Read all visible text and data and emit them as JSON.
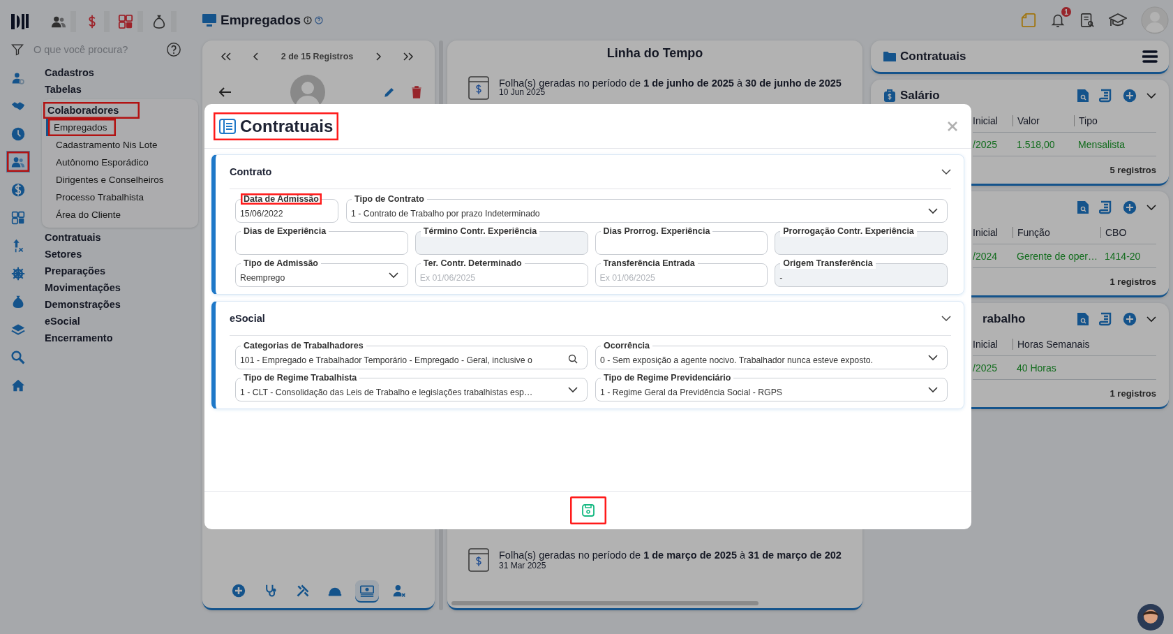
{
  "rail": {
    "items": [
      {
        "kind": "user-gear",
        "selected": false,
        "highlighted": false
      },
      {
        "kind": "handshake",
        "selected": false,
        "highlighted": false
      },
      {
        "kind": "clock",
        "selected": false,
        "highlighted": false
      },
      {
        "kind": "people",
        "selected": true,
        "highlighted": true
      },
      {
        "kind": "dollar",
        "selected": false,
        "highlighted": false
      },
      {
        "kind": "calculator",
        "selected": false,
        "highlighted": false
      },
      {
        "kind": "pin",
        "selected": false,
        "highlighted": false
      },
      {
        "kind": "gear",
        "selected": false,
        "highlighted": false
      },
      {
        "kind": "money-bag",
        "selected": false,
        "highlighted": false
      },
      {
        "kind": "layers",
        "selected": false,
        "highlighted": false
      },
      {
        "kind": "search",
        "selected": false,
        "highlighted": false
      },
      {
        "kind": "home",
        "selected": false,
        "highlighted": false
      }
    ]
  },
  "top_modules": [
    {
      "kind": "people"
    },
    {
      "kind": "dollar"
    },
    {
      "kind": "calculator"
    },
    {
      "kind": "money-bag"
    }
  ],
  "search": {
    "placeholder": "O que você procura?"
  },
  "menu": [
    {
      "label": "Cadastros",
      "expanded": false,
      "highlighted": false
    },
    {
      "label": "Tabelas",
      "expanded": false,
      "highlighted": false
    },
    {
      "label": "Colaboradores",
      "expanded": true,
      "highlighted": true,
      "children": [
        {
          "label": "Empregados",
          "selected": true,
          "highlighted": true
        },
        {
          "label": "Cadastramento Nis Lote",
          "selected": false,
          "highlighted": false
        },
        {
          "label": "Autônomo Esporádico",
          "selected": false,
          "highlighted": false
        },
        {
          "label": "Dirigentes e Conselheiros",
          "selected": false,
          "highlighted": false
        },
        {
          "label": "Processo Trabalhista",
          "selected": false,
          "highlighted": false
        },
        {
          "label": "Área do Cliente",
          "selected": false,
          "highlighted": false
        }
      ]
    },
    {
      "label": "Contratuais",
      "expanded": false,
      "highlighted": false
    },
    {
      "label": "Setores",
      "expanded": false,
      "highlighted": false
    },
    {
      "label": "Preparações",
      "expanded": false,
      "highlighted": false
    },
    {
      "label": "Movimentações",
      "expanded": false,
      "highlighted": false
    },
    {
      "label": "Demonstrações",
      "expanded": false,
      "highlighted": false
    },
    {
      "label": "eSocial",
      "expanded": false,
      "highlighted": false
    },
    {
      "label": "Encerramento",
      "expanded": false,
      "highlighted": false
    }
  ],
  "page": {
    "title": "Empregados"
  },
  "notifications": {
    "count": "1"
  },
  "record_nav": {
    "label": "2 de 15 Registros"
  },
  "employee_tabs": [
    {
      "kind": "plus",
      "selected": false
    },
    {
      "kind": "stethoscope",
      "selected": false
    },
    {
      "kind": "tools",
      "selected": false
    },
    {
      "kind": "helmet",
      "selected": false
    },
    {
      "kind": "money",
      "selected": true
    },
    {
      "kind": "user-remove",
      "selected": false
    }
  ],
  "timeline": {
    "title": "Linha do Tempo",
    "entries": [
      {
        "text": "Folha(s) geradas no período de **1 de junho de 2025** à **30 de junho de 2025**",
        "date": "10 Jun 2025"
      },
      {
        "text": "Folha(s) geradas no período de **1 de março de 2025** à **31 de março de 202**",
        "date": "31 Mar 2025"
      }
    ]
  },
  "contracts_panel": {
    "title": "Contratuais",
    "cards": [
      {
        "kind": "full",
        "title": "Salário",
        "columns": [
          "Inicial",
          "Valor",
          "Tipo"
        ],
        "row": [
          "/2025",
          "1.518,00",
          "Mensalista"
        ],
        "footer": "5 registros"
      },
      {
        "kind": "covered",
        "columns": [
          "Inicial",
          "Função",
          "CBO"
        ],
        "row": [
          "/2024",
          "Gerente de oper…",
          "1414-20"
        ],
        "footer": "1 registros"
      },
      {
        "kind": "covered",
        "title": "rabalho",
        "columns": [
          "Inicial",
          "Horas Semanais"
        ],
        "row": [
          "/2025",
          "40 Horas"
        ],
        "footer": "1 registros"
      }
    ]
  },
  "modal": {
    "title": "Contratuais",
    "highlighted": true,
    "save_highlighted": true,
    "sections": [
      {
        "title": "Contrato",
        "expanded": true,
        "rows": [
          [
            {
              "label": "Data de Admissão",
              "value": "15/06/2022",
              "kind": "text",
              "highlighted": true
            },
            {
              "label": "Tipo de Contrato",
              "value": "1 - Contrato de Trabalho por prazo Indeterminado",
              "kind": "select",
              "highlighted": false
            }
          ],
          [
            {
              "label": "Dias de Experiência",
              "kind": "text",
              "highlighted": false
            },
            {
              "label": "Término Contr. Experiência",
              "kind": "readonly",
              "highlighted": false
            },
            {
              "label": "Dias Prorrog. Experiência",
              "kind": "text",
              "highlighted": false
            },
            {
              "label": "Prorrogação Contr. Experiência",
              "kind": "readonly",
              "highlighted": false
            }
          ],
          [
            {
              "label": "Tipo de Admissão",
              "value": "Reemprego",
              "kind": "select",
              "highlighted": false
            },
            {
              "label": "Ter. Contr. Determinado",
              "placeholder": "Ex 01/06/2025",
              "kind": "text",
              "highlighted": false
            },
            {
              "label": "Transferência Entrada",
              "placeholder": "Ex 01/06/2025",
              "kind": "text",
              "highlighted": false
            },
            {
              "label": "Origem Transferência",
              "value": "-",
              "kind": "readonly",
              "highlighted": false
            }
          ]
        ]
      },
      {
        "title": "eSocial",
        "expanded": true,
        "rows": [
          [
            {
              "label": "Categorias de Trabalhadores",
              "value": "101 - Empregado e Trabalhador Temporário - Empregado - Geral, inclusive o",
              "kind": "search",
              "highlighted": false
            },
            {
              "label": "Ocorrência",
              "value": "0 - Sem exposição a agente nocivo. Trabalhador nunca esteve exposto.",
              "kind": "select",
              "highlighted": false
            }
          ],
          [
            {
              "label": "Tipo de Regime Trabalhista",
              "value": "1 - CLT - Consolidação das Leis de Trabalho e legislações trabalhistas esp…",
              "kind": "select",
              "highlighted": false
            },
            {
              "label": "Tipo de Regime Previdenciário",
              "value": "1 - Regime Geral da Previdência Social - RGPS",
              "kind": "select",
              "highlighted": false
            }
          ]
        ]
      }
    ]
  }
}
